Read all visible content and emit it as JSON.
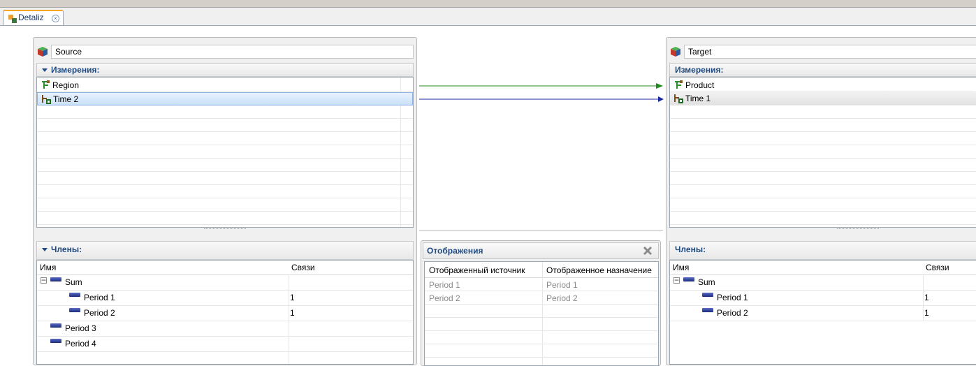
{
  "tab": {
    "label": "Detaliz",
    "close_icon": "close-icon"
  },
  "source": {
    "name": "Source",
    "dimensions_header": "Измерения:",
    "dimensions": [
      {
        "label": "Region",
        "icon": "hierarchy-icon"
      },
      {
        "label": "Time 2",
        "icon": "time-dimension-icon",
        "selected": true
      }
    ],
    "members_header": "Члены:",
    "members_columns": [
      "Имя",
      "Связи"
    ],
    "members": [
      {
        "name": "Sum",
        "links": "",
        "expander": "−"
      },
      {
        "name": "Period 1",
        "links": "1"
      },
      {
        "name": "Period 2",
        "links": "1"
      },
      {
        "name": "Period 3",
        "links": ""
      },
      {
        "name": "Period 4",
        "links": ""
      }
    ]
  },
  "target": {
    "name": "Target",
    "dimensions_header": "Измерения:",
    "dimensions": [
      {
        "label": "Product",
        "icon": "hierarchy-icon"
      },
      {
        "label": "Time 1",
        "icon": "time-dimension-icon",
        "selected": true
      }
    ],
    "members_header": "Члены:",
    "members_columns": [
      "Имя",
      "Связи"
    ],
    "members": [
      {
        "name": "Sum",
        "links": "",
        "expander": "−"
      },
      {
        "name": "Period 1",
        "links": "1"
      },
      {
        "name": "Period 2",
        "links": "1"
      }
    ]
  },
  "mappings": {
    "title": "Отображения",
    "columns": [
      "Отображенный источник",
      "Отображенное назначение"
    ],
    "rows": [
      {
        "source": "Period 1",
        "target": "Period 1"
      },
      {
        "source": "Period 2",
        "target": "Period 2"
      }
    ]
  },
  "links": {
    "green": "#1f8a1f",
    "blue": "#1a2aa0"
  }
}
